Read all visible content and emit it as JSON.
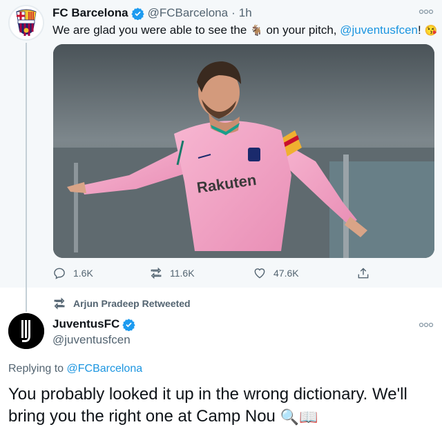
{
  "tweet1": {
    "author_name": "FC Barcelona",
    "author_handle": "@FCBarcelona",
    "separator": "·",
    "time": "1h",
    "text_before": "We are glad you were able to see the",
    "emoji_goat": "🐐",
    "text_middle": "on your pitch,",
    "mention": "@juventusfcen",
    "text_after": "!",
    "emoji_kiss": "😘",
    "image_sponsor": "Rakuten",
    "more_icon": "more-dots-icon",
    "actions": {
      "replies": "1.6K",
      "retweets": "11.6K",
      "likes": "47.6K"
    }
  },
  "retweet_context": {
    "label": "Arjun Pradeep Retweeted"
  },
  "tweet2": {
    "author_name": "JuventusFC",
    "author_handle": "@juventusfcen",
    "replying_prefix": "Replying to",
    "replying_to": "@FCBarcelona",
    "text": "You probably looked it up in the wrong dictionary. We'll bring you the right one at Camp Nou",
    "emoji_magnifier": "🔍",
    "emoji_book": "📖"
  },
  "colors": {
    "link": "#1b95e0",
    "verified": "#1d9bf0",
    "muted": "#536471",
    "pink_kit": "#f4a6c8"
  }
}
